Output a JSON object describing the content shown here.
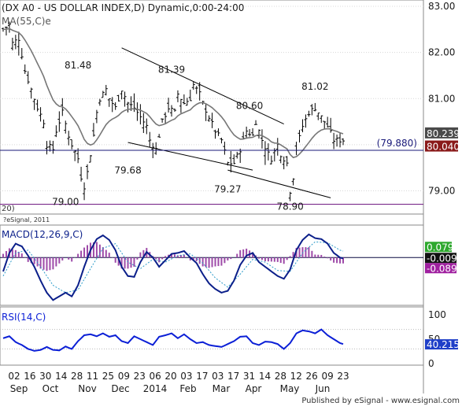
{
  "colors": {
    "background": "#ffffff",
    "axis_text": "#1a1a1a",
    "price_bars": "#000000",
    "ma_line": "#777777",
    "macd_line": "#0b1f8a",
    "signal_line": "#2b9bc9",
    "histogram": "#9e4aa8",
    "rsi_line": "#0b1fd6",
    "support_line": "#1a1a7a",
    "lower_line": "#7a2a8a",
    "current_price_box": "#8a1a1a",
    "ma_value_box": "#4a4a4a",
    "macd_value_box": "#2ea82e",
    "signal_value_box": "#111111",
    "hist_value_box": "#a020a0",
    "rsi_value_box": "#1f3fc8",
    "panel_border": "#888888",
    "ref_line": "#0a0a40"
  },
  "header": {
    "title": "(DX A0 - US DOLLAR INDEX,D) Dynamic,0:00-24:00",
    "ma_label": "MA(55,C)e",
    "copyright": "?eSignal, 2011",
    "left_cut": "20)"
  },
  "footer": {
    "published_by": "Published by eSignal - www.esignal.com"
  },
  "chart_data": [
    {
      "type": "ohlc",
      "title": "(DX A0 - US DOLLAR INDEX,D) Dynamic,0:00-24:00",
      "x_tick_labels": [
        "02",
        "16",
        "30",
        "14",
        "28",
        "11",
        "25",
        "09",
        "23",
        "06",
        "20",
        "03",
        "17",
        "03",
        "17",
        "31",
        "14",
        "28",
        "12",
        "26",
        "09",
        "23"
      ],
      "x_month_labels": [
        "Sep",
        "Oct",
        "Nov",
        "Dec",
        "2014",
        "Feb",
        "Mar",
        "Apr",
        "May",
        "Jun"
      ],
      "ylim": [
        78.6,
        83.0
      ],
      "y_ticks": [
        79.0,
        80.0,
        81.0,
        82.0,
        83.0
      ],
      "y_tick_labels": [
        "79.00",
        "80.00",
        "81.00",
        "82.00",
        "83.00"
      ],
      "current_value": "80.040",
      "ma_value": "80.239",
      "support_level": "(79.880)",
      "support_value": 79.88,
      "moving_average": "MA(55,C)e",
      "close_path": [
        [
          0,
          82.5
        ],
        [
          2,
          82.6
        ],
        [
          3,
          82.2
        ],
        [
          5,
          82.3
        ],
        [
          7,
          81.6
        ],
        [
          9,
          81.2
        ],
        [
          11,
          80.8
        ],
        [
          13,
          80.5
        ],
        [
          14,
          80.0
        ],
        [
          16,
          79.9
        ],
        [
          17,
          80.3
        ],
        [
          19,
          80.7
        ],
        [
          21,
          80.2
        ],
        [
          22,
          80.0
        ],
        [
          24,
          79.7
        ],
        [
          25,
          79.3
        ],
        [
          26,
          79.1
        ],
        [
          27,
          79.4
        ],
        [
          28,
          79.8
        ],
        [
          29,
          80.2
        ],
        [
          30,
          80.7
        ],
        [
          31,
          81.0
        ],
        [
          33,
          81.2
        ],
        [
          34,
          81.0
        ],
        [
          36,
          80.8
        ],
        [
          38,
          81.2
        ],
        [
          40,
          80.9
        ],
        [
          42,
          80.8
        ],
        [
          44,
          80.6
        ],
        [
          46,
          80.4
        ],
        [
          47,
          80.1
        ],
        [
          49,
          79.9
        ],
        [
          50,
          80.2
        ],
        [
          51,
          80.5
        ],
        [
          53,
          80.8
        ],
        [
          55,
          80.7
        ],
        [
          56,
          81.1
        ],
        [
          58,
          80.9
        ],
        [
          60,
          81.0
        ],
        [
          61,
          81.3
        ],
        [
          63,
          81.1
        ],
        [
          64,
          80.9
        ],
        [
          66,
          80.6
        ],
        [
          68,
          80.3
        ],
        [
          70,
          80.1
        ],
        [
          72,
          79.6
        ],
        [
          74,
          79.6
        ],
        [
          76,
          79.9
        ],
        [
          78,
          80.3
        ],
        [
          80,
          80.2
        ],
        [
          81,
          80.5
        ],
        [
          83,
          80.1
        ],
        [
          85,
          79.8
        ],
        [
          86,
          79.7
        ],
        [
          88,
          80.0
        ],
        [
          89,
          79.8
        ],
        [
          91,
          79.6
        ],
        [
          92,
          79.0
        ],
        [
          93,
          79.3
        ],
        [
          94,
          79.9
        ],
        [
          96,
          80.4
        ],
        [
          98,
          80.7
        ],
        [
          100,
          80.8
        ],
        [
          102,
          80.6
        ],
        [
          104,
          80.4
        ],
        [
          106,
          80.1
        ],
        [
          107,
          80.1
        ],
        [
          109,
          80.1
        ]
      ],
      "swing_labels": [
        {
          "label": "81.48",
          "bar": 24
        },
        {
          "label": "81.39",
          "bar": 54
        },
        {
          "label": "80.60",
          "bar": 79
        },
        {
          "label": "81.02",
          "bar": 100
        },
        {
          "label": "79.00",
          "bar": 20
        },
        {
          "label": "79.68",
          "bar": 40
        },
        {
          "label": "79.27",
          "bar": 72
        },
        {
          "label": "78.90",
          "bar": 92
        }
      ]
    },
    {
      "type": "line",
      "title": "MACD(12,26,9,C)",
      "series_names": [
        "MACD",
        "Signal",
        "Histogram"
      ],
      "values_shown": [
        "0.079",
        "-0.009",
        "-0.089"
      ],
      "zero_label": "0",
      "macd_path": [
        [
          0,
          -0.15
        ],
        [
          2,
          0.05
        ],
        [
          4,
          0.15
        ],
        [
          6,
          0.12
        ],
        [
          8,
          0.02
        ],
        [
          10,
          -0.1
        ],
        [
          12,
          -0.25
        ],
        [
          14,
          -0.38
        ],
        [
          16,
          -0.46
        ],
        [
          18,
          -0.42
        ],
        [
          20,
          -0.38
        ],
        [
          22,
          -0.42
        ],
        [
          24,
          -0.3
        ],
        [
          26,
          -0.1
        ],
        [
          28,
          0.08
        ],
        [
          30,
          0.2
        ],
        [
          32,
          0.24
        ],
        [
          34,
          0.19
        ],
        [
          36,
          0.08
        ],
        [
          38,
          -0.1
        ],
        [
          40,
          -0.2
        ],
        [
          42,
          -0.21
        ],
        [
          44,
          -0.05
        ],
        [
          46,
          0.06
        ],
        [
          48,
          0.0
        ],
        [
          50,
          -0.1
        ],
        [
          52,
          -0.03
        ],
        [
          54,
          0.04
        ],
        [
          56,
          0.05
        ],
        [
          58,
          0.07
        ],
        [
          60,
          0.0
        ],
        [
          62,
          -0.06
        ],
        [
          64,
          -0.18
        ],
        [
          66,
          -0.28
        ],
        [
          68,
          -0.34
        ],
        [
          70,
          -0.38
        ],
        [
          72,
          -0.36
        ],
        [
          74,
          -0.25
        ],
        [
          76,
          -0.08
        ],
        [
          78,
          0.02
        ],
        [
          80,
          0.05
        ],
        [
          82,
          -0.05
        ],
        [
          84,
          -0.1
        ],
        [
          86,
          -0.15
        ],
        [
          88,
          -0.2
        ],
        [
          90,
          -0.23
        ],
        [
          92,
          -0.13
        ],
        [
          94,
          0.08
        ],
        [
          96,
          0.19
        ],
        [
          98,
          0.25
        ],
        [
          100,
          0.21
        ],
        [
          102,
          0.2
        ],
        [
          104,
          0.15
        ],
        [
          106,
          0.05
        ],
        [
          108,
          0.0
        ],
        [
          109,
          -0.01
        ]
      ],
      "signal_path": [
        [
          0,
          -0.2
        ],
        [
          4,
          0.05
        ],
        [
          8,
          0.08
        ],
        [
          12,
          -0.1
        ],
        [
          16,
          -0.3
        ],
        [
          20,
          -0.38
        ],
        [
          24,
          -0.35
        ],
        [
          28,
          -0.12
        ],
        [
          32,
          0.1
        ],
        [
          36,
          0.15
        ],
        [
          40,
          -0.05
        ],
        [
          44,
          -0.12
        ],
        [
          48,
          -0.02
        ],
        [
          52,
          -0.05
        ],
        [
          56,
          0.02
        ],
        [
          60,
          0.04
        ],
        [
          64,
          -0.06
        ],
        [
          68,
          -0.22
        ],
        [
          72,
          -0.32
        ],
        [
          76,
          -0.18
        ],
        [
          80,
          -0.02
        ],
        [
          84,
          -0.05
        ],
        [
          88,
          -0.14
        ],
        [
          92,
          -0.15
        ],
        [
          96,
          0.05
        ],
        [
          100,
          0.17
        ],
        [
          104,
          0.16
        ],
        [
          108,
          0.08
        ],
        [
          109,
          0.07
        ]
      ],
      "ylim": [
        -0.5,
        0.3
      ]
    },
    {
      "type": "line",
      "title": "RSI(14,C)",
      "y_ticks": [
        0,
        50,
        100
      ],
      "y_tick_labels": [
        "0",
        "50",
        "100"
      ],
      "value_shown": "40.215",
      "ylim": [
        0,
        100
      ],
      "rsi_path": [
        [
          0,
          52
        ],
        [
          2,
          56
        ],
        [
          4,
          44
        ],
        [
          6,
          38
        ],
        [
          8,
          30
        ],
        [
          10,
          26
        ],
        [
          12,
          28
        ],
        [
          14,
          34
        ],
        [
          16,
          28
        ],
        [
          18,
          27
        ],
        [
          20,
          35
        ],
        [
          22,
          30
        ],
        [
          24,
          46
        ],
        [
          26,
          58
        ],
        [
          28,
          60
        ],
        [
          30,
          56
        ],
        [
          32,
          62
        ],
        [
          34,
          55
        ],
        [
          36,
          58
        ],
        [
          38,
          46
        ],
        [
          40,
          42
        ],
        [
          42,
          56
        ],
        [
          44,
          50
        ],
        [
          46,
          44
        ],
        [
          48,
          38
        ],
        [
          50,
          55
        ],
        [
          52,
          58
        ],
        [
          54,
          62
        ],
        [
          56,
          52
        ],
        [
          58,
          60
        ],
        [
          60,
          50
        ],
        [
          62,
          42
        ],
        [
          64,
          44
        ],
        [
          66,
          38
        ],
        [
          68,
          36
        ],
        [
          70,
          34
        ],
        [
          72,
          40
        ],
        [
          74,
          46
        ],
        [
          76,
          55
        ],
        [
          78,
          56
        ],
        [
          80,
          42
        ],
        [
          82,
          38
        ],
        [
          84,
          45
        ],
        [
          86,
          44
        ],
        [
          88,
          40
        ],
        [
          90,
          30
        ],
        [
          92,
          42
        ],
        [
          94,
          62
        ],
        [
          96,
          68
        ],
        [
          98,
          66
        ],
        [
          100,
          62
        ],
        [
          102,
          70
        ],
        [
          104,
          58
        ],
        [
          106,
          50
        ],
        [
          108,
          42
        ],
        [
          109,
          40
        ]
      ]
    }
  ]
}
